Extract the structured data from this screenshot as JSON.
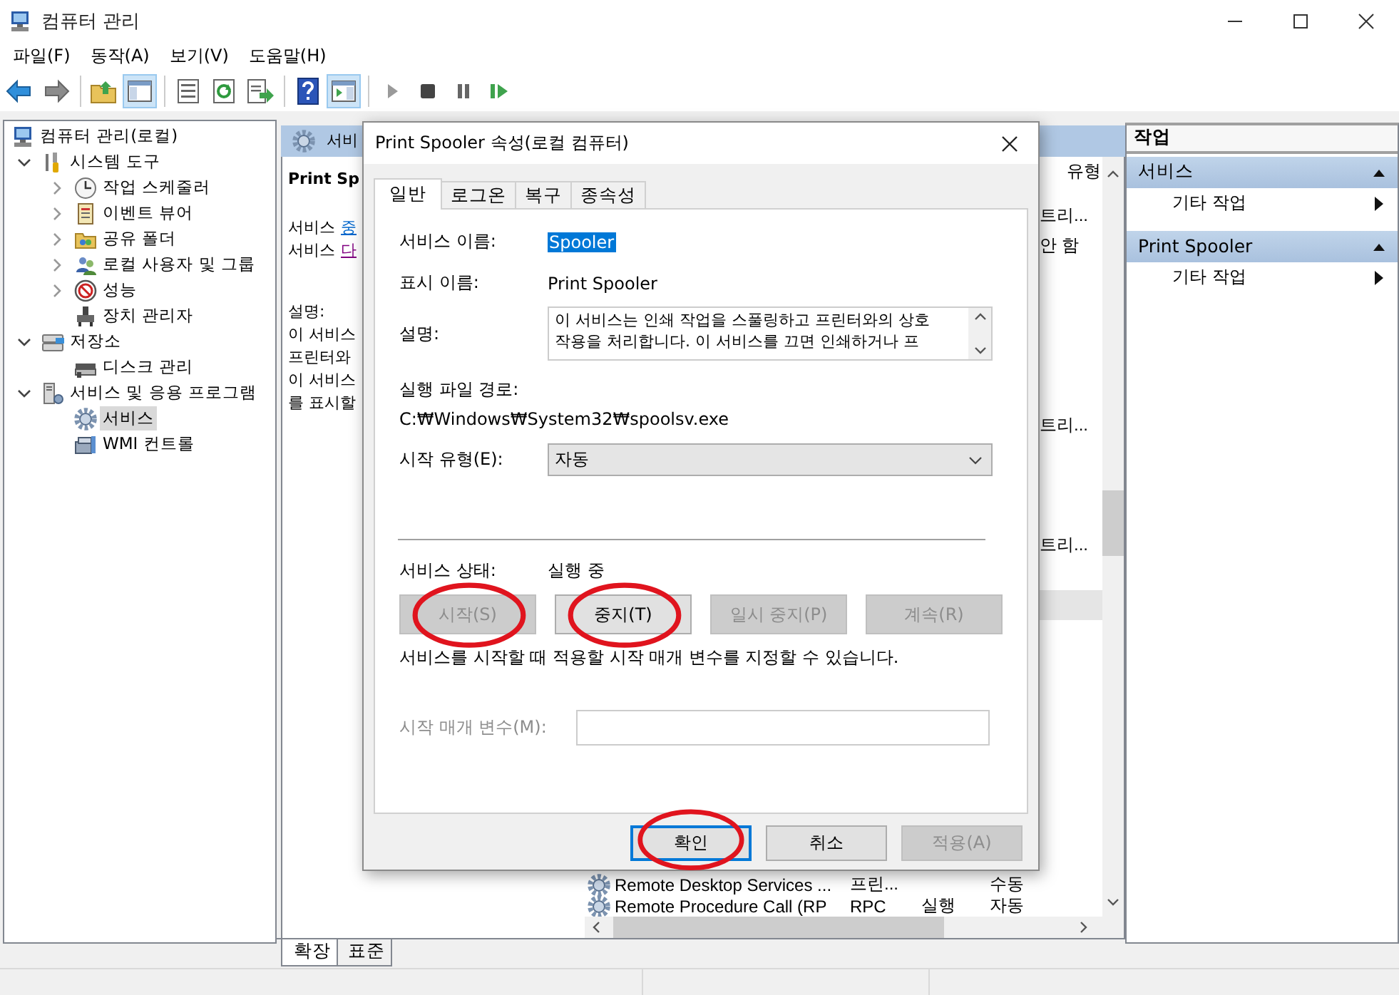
{
  "window": {
    "title": "컴퓨터 관리"
  },
  "menu": [
    "파일(F)",
    "동작(A)",
    "보기(V)",
    "도움말(H)"
  ],
  "toolbar": [
    {
      "kind": "back",
      "pressed": false
    },
    {
      "kind": "forward",
      "pressed": false
    },
    {
      "kind": "separator"
    },
    {
      "kind": "up",
      "pressed": false
    },
    {
      "kind": "tree",
      "pressed": true
    },
    {
      "kind": "separator"
    },
    {
      "kind": "properties",
      "pressed": false
    },
    {
      "kind": "refresh",
      "pressed": false
    },
    {
      "kind": "export",
      "pressed": false
    },
    {
      "kind": "separator"
    },
    {
      "kind": "help",
      "pressed": false
    },
    {
      "kind": "actionpane",
      "pressed": true
    },
    {
      "kind": "separator"
    },
    {
      "kind": "play",
      "pressed": false
    },
    {
      "kind": "stop",
      "pressed": false
    },
    {
      "kind": "pause",
      "pressed": false
    },
    {
      "kind": "resume",
      "pressed": false
    }
  ],
  "tree": {
    "label": "컴퓨터 관리(로컬)",
    "kind": "computer",
    "selected": false,
    "children": [
      {
        "label": "시스템 도구",
        "kind": "tools",
        "expandable": true,
        "expanded": true,
        "selected": false,
        "children": [
          {
            "label": "작업 스케줄러",
            "kind": "clock",
            "expandable": true,
            "expanded": false,
            "selected": false
          },
          {
            "label": "이벤트 뷰어",
            "kind": "log",
            "expandable": true,
            "expanded": false,
            "selected": false
          },
          {
            "label": "공유 폴더",
            "kind": "folder",
            "expandable": true,
            "expanded": false,
            "selected": false
          },
          {
            "label": "로컬 사용자 및 그룹",
            "kind": "users",
            "expandable": true,
            "expanded": false,
            "selected": false
          },
          {
            "label": "성능",
            "kind": "perf",
            "expandable": true,
            "expanded": false,
            "selected": false
          },
          {
            "label": "장치 관리자",
            "kind": "device",
            "expandable": false,
            "selected": false
          }
        ]
      },
      {
        "label": "저장소",
        "kind": "storage",
        "expandable": true,
        "expanded": true,
        "selected": false,
        "children": [
          {
            "label": "디스크 관리",
            "kind": "disk",
            "expandable": false,
            "selected": false
          }
        ]
      },
      {
        "label": "서비스 및 응용 프로그램",
        "kind": "server",
        "expandable": true,
        "expanded": true,
        "selected": false,
        "children": [
          {
            "label": "서비스",
            "kind": "gear",
            "expandable": false,
            "selected": true
          },
          {
            "label": "WMI 컨트롤",
            "kind": "wmi",
            "expandable": false,
            "selected": false
          }
        ]
      }
    ]
  },
  "middle": {
    "header": "서비",
    "detail": {
      "title": "Print Sp",
      "links": [
        {
          "prefix": "서비스",
          "link": "중",
          "visited": false
        },
        {
          "prefix": "서비스",
          "link": "다",
          "visited": true
        }
      ],
      "description_label": "설명:",
      "description_lines": [
        "이 서비스",
        "프린터와",
        "이 서비스",
        "를 표시할"
      ]
    },
    "list": {
      "header": "유형",
      "rows": [
        {
          "startup_type": "트리...",
          "selected": false
        },
        {
          "startup_type": "안 함",
          "selected": false
        },
        {
          "selected": false
        },
        {
          "selected": false
        },
        {
          "selected": false
        },
        {
          "selected": false
        },
        {
          "selected": false
        },
        {
          "startup_type": "트리...",
          "selected": false
        },
        {
          "selected": false
        },
        {
          "selected": false
        },
        {
          "selected": false
        },
        {
          "startup_type": "트리...",
          "selected": false
        },
        {
          "selected": false
        },
        {
          "selected": true
        }
      ],
      "bottom_rows": [
        {
          "name": "Remote Desktop Services ...",
          "description": "프린...",
          "startup_type": "수동"
        },
        {
          "name": "Remote Procedure Call (RP",
          "description": "RPC",
          "status": "실행",
          "startup_type": "자동"
        }
      ]
    },
    "view_tabs": [
      {
        "label": "확장",
        "selected": true
      },
      {
        "label": "표준",
        "selected": false
      }
    ]
  },
  "actions": {
    "title": "작업",
    "sections": [
      {
        "title": "서비스",
        "expanded": true,
        "items": [
          "기타 작업"
        ]
      },
      {
        "title": "Print Spooler",
        "expanded": true,
        "items": [
          "기타 작업"
        ]
      }
    ]
  },
  "dialog": {
    "title": "Print Spooler 속성(로컬 컴퓨터)",
    "tabs": [
      {
        "label": "일반",
        "selected": true
      },
      {
        "label": "로그온",
        "selected": false
      },
      {
        "label": "복구",
        "selected": false
      },
      {
        "label": "종속성",
        "selected": false
      }
    ],
    "service_name": {
      "label": "서비스 이름:",
      "value": "Spooler"
    },
    "display_name": {
      "label": "표시 이름:",
      "value": "Print Spooler"
    },
    "description": {
      "label": "설명:",
      "lines": [
        "이 서비스는 인쇄 작업을 스풀링하고 프린터와의 상호",
        "작용을 처리합니다. 이 서비스를 끄면 인쇄하거나 프"
      ]
    },
    "path": {
      "label": "실행 파일 경로:",
      "value": "C:₩Windows₩System32₩spoolsv.exe"
    },
    "startup_type": {
      "label": "시작 유형(E):",
      "value": "자동"
    },
    "status": {
      "label": "서비스 상태:",
      "value": "실행 중"
    },
    "control_buttons": [
      {
        "label": "시작(S)",
        "disabled": true,
        "circled": true
      },
      {
        "label": "중지(T)",
        "disabled": false,
        "circled": true
      },
      {
        "label": "일시 중지(P)",
        "disabled": true,
        "circled": false
      },
      {
        "label": "계속(R)",
        "disabled": true,
        "circled": false
      }
    ],
    "hint": "서비스를 시작할 때 적용할 시작 매개 변수를 지정할 수 있습니다.",
    "parameters": {
      "label": "시작 매개 변수(M):",
      "disabled": true
    },
    "buttons": [
      {
        "label": "확인",
        "default": true,
        "disabled": false,
        "circled": true
      },
      {
        "label": "취소",
        "default": false,
        "disabled": false,
        "circled": false
      },
      {
        "label": "적용(A)",
        "default": false,
        "disabled": true,
        "circled": false
      }
    ]
  }
}
